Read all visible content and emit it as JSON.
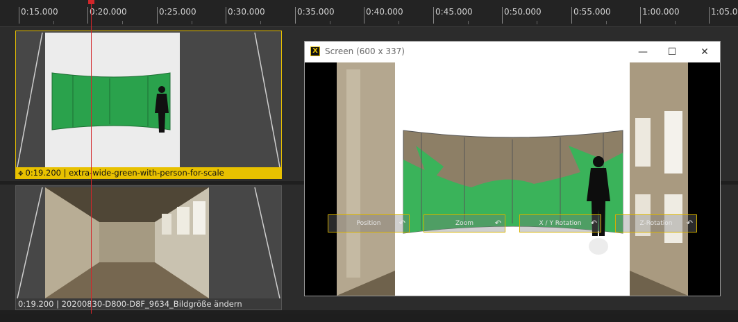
{
  "ruler": {
    "ticks": [
      "0:15.000",
      "0:20.000",
      "0:25.000",
      "0:30.000",
      "0:35.000",
      "0:40.000",
      "0:45.000",
      "0:50.000",
      "0:55.000",
      "1:00.000",
      "1:05.0"
    ]
  },
  "clips": [
    {
      "label": "0:19.200 | extra-wide-green-with-person-for-scale",
      "icon": "hand-move-icon"
    },
    {
      "label": "0:19.200 | 20200830-D800-D8F_9634_Bildgröße ändern"
    }
  ],
  "screen_window": {
    "app_icon_glyph": "X",
    "title": "Screen (600 x 337)",
    "minimize_glyph": "—",
    "maximize_glyph": "☐",
    "close_glyph": "✕"
  },
  "controls": [
    {
      "label": "Position"
    },
    {
      "label": "Zoom"
    },
    {
      "label": "X / Y Rotation"
    },
    {
      "label": "Z-Rotation"
    }
  ],
  "reset_glyph": "↶",
  "colors": {
    "accent": "#e8c100",
    "playhead": "#d3262a",
    "green_screen": "#2fa84f"
  }
}
